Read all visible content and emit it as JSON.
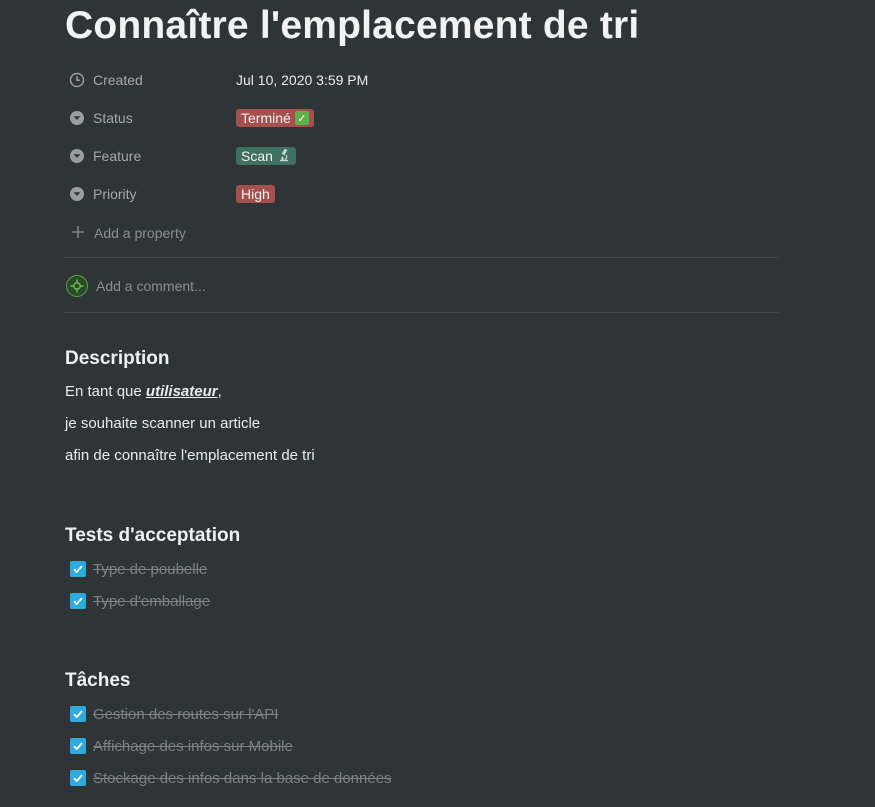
{
  "page": {
    "title": "Connaître l'emplacement de tri"
  },
  "properties": {
    "created": {
      "label": "Created",
      "value": "Jul 10, 2020 3:59 PM",
      "icon": "clock-icon"
    },
    "status": {
      "label": "Status",
      "value": "Terminé",
      "emoji": "✓",
      "icon": "select-icon",
      "color": "#a4504f"
    },
    "feature": {
      "label": "Feature",
      "value": "Scan",
      "emoji": "microscope",
      "icon": "select-icon",
      "color": "#3e7160"
    },
    "priority": {
      "label": "Priority",
      "value": "High",
      "icon": "select-icon",
      "color": "#a4504f"
    },
    "add_label": "Add a property"
  },
  "comment": {
    "placeholder": "Add a comment..."
  },
  "description": {
    "heading": "Description",
    "line1_prefix": "En tant que ",
    "line1_emphasis": "utilisateur",
    "line1_suffix": ",",
    "line2": "je souhaite scanner un article",
    "line3": "afin de connaître l'emplacement de tri"
  },
  "acceptance": {
    "heading": "Tests d'acceptation",
    "items": [
      {
        "label": "Type de poubelle",
        "checked": true
      },
      {
        "label": "Type d'emballage",
        "checked": true
      }
    ]
  },
  "tasks": {
    "heading": "Tâches",
    "items": [
      {
        "label": "Gestion des routes sur l'API",
        "checked": true
      },
      {
        "label": "Affichage des infos sur Mobile",
        "checked": true
      },
      {
        "label": "Stockage des infos dans la base de données",
        "checked": true
      }
    ]
  },
  "colors": {
    "background": "#2f3437",
    "checkbox": "#2eaadc",
    "tag_red": "#a4504f",
    "tag_green": "#3e7160"
  }
}
